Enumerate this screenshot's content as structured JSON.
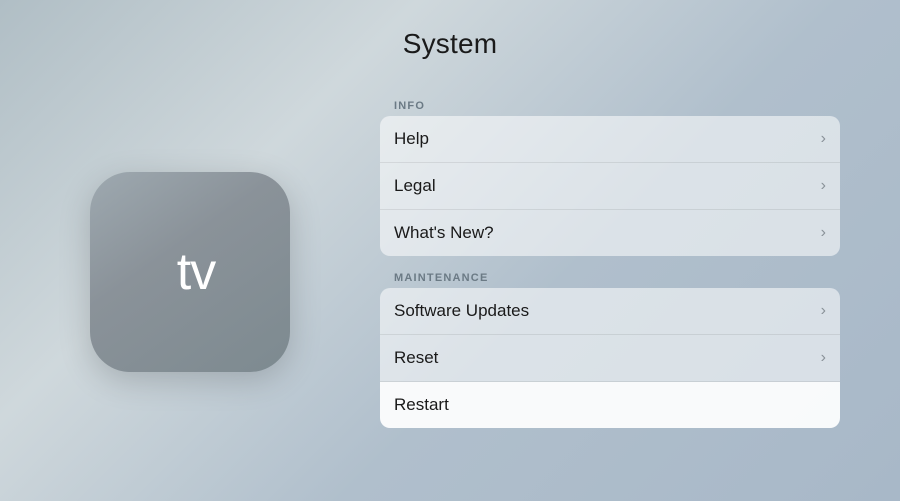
{
  "page": {
    "title": "System"
  },
  "appletv_icon": {
    "apple_symbol": "",
    "tv_label": "tv"
  },
  "sections": [
    {
      "id": "info",
      "label": "INFO",
      "items": [
        {
          "id": "help",
          "label": "Help",
          "has_chevron": true,
          "active": false
        },
        {
          "id": "legal",
          "label": "Legal",
          "has_chevron": true,
          "active": false
        },
        {
          "id": "whats-new",
          "label": "What's New?",
          "has_chevron": true,
          "active": false
        }
      ]
    },
    {
      "id": "maintenance",
      "label": "MAINTENANCE",
      "items": [
        {
          "id": "software-updates",
          "label": "Software Updates",
          "has_chevron": true,
          "active": false
        },
        {
          "id": "reset",
          "label": "Reset",
          "has_chevron": true,
          "active": false
        },
        {
          "id": "restart",
          "label": "Restart",
          "has_chevron": false,
          "active": true
        }
      ]
    }
  ]
}
